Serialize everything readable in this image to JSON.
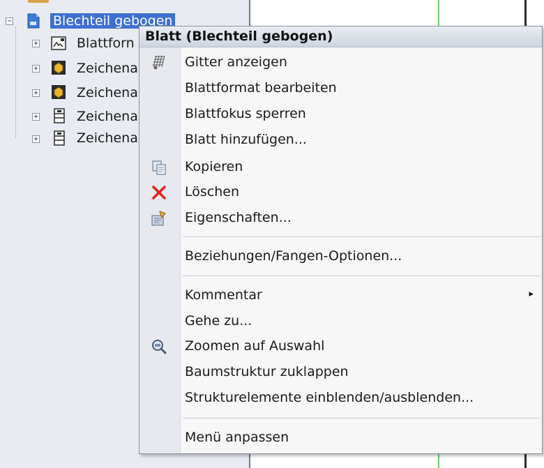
{
  "tree": {
    "items": [
      {
        "label": "Blechteil gebogen",
        "expander": "−",
        "icon": "sheet-icon",
        "selected": true
      },
      {
        "label": "Blattforn",
        "expander": "+",
        "icon": "sheet-format-icon"
      },
      {
        "label": "Zeichena",
        "expander": "+",
        "icon": "drawing-view-icon"
      },
      {
        "label": "Zeichena",
        "expander": "+",
        "icon": "drawing-view-icon"
      },
      {
        "label": "Zeichena",
        "expander": "+",
        "icon": "section-view-icon"
      },
      {
        "label": "Zeichena",
        "expander": "+",
        "icon": "section-view-icon"
      }
    ]
  },
  "menu": {
    "title": "Blatt (Blechteil gebogen)",
    "items": [
      {
        "label": "Gitter anzeigen",
        "icon": "grid-icon"
      },
      {
        "label": "Blattformat bearbeiten",
        "icon": ""
      },
      {
        "label": "Blattfokus sperren",
        "icon": ""
      },
      {
        "label": "Blatt hinzufügen...",
        "icon": ""
      },
      {
        "label": "Kopieren",
        "icon": "copy-icon"
      },
      {
        "label": "Löschen",
        "icon": "delete-icon"
      },
      {
        "label": "Eigenschaften...",
        "icon": "properties-icon"
      },
      {
        "label": "Beziehungen/Fangen-Optionen...",
        "icon": ""
      },
      {
        "label": "Kommentar",
        "icon": "",
        "submenu": "▸"
      },
      {
        "label": "Gehe zu...",
        "icon": ""
      },
      {
        "label": "Zoomen auf Auswahl",
        "icon": "zoom-icon"
      },
      {
        "label": "Baumstruktur zuklappen",
        "icon": ""
      },
      {
        "label": "Strukturelemente einblenden/ausblenden...",
        "icon": ""
      },
      {
        "label": "Menü anpassen",
        "icon": ""
      }
    ]
  },
  "colors": {
    "selection": "#3f6fd0",
    "delete_icon": "#e3221b",
    "tree_background": "#e8ebf1",
    "menu_background": "#f7f7f7"
  }
}
